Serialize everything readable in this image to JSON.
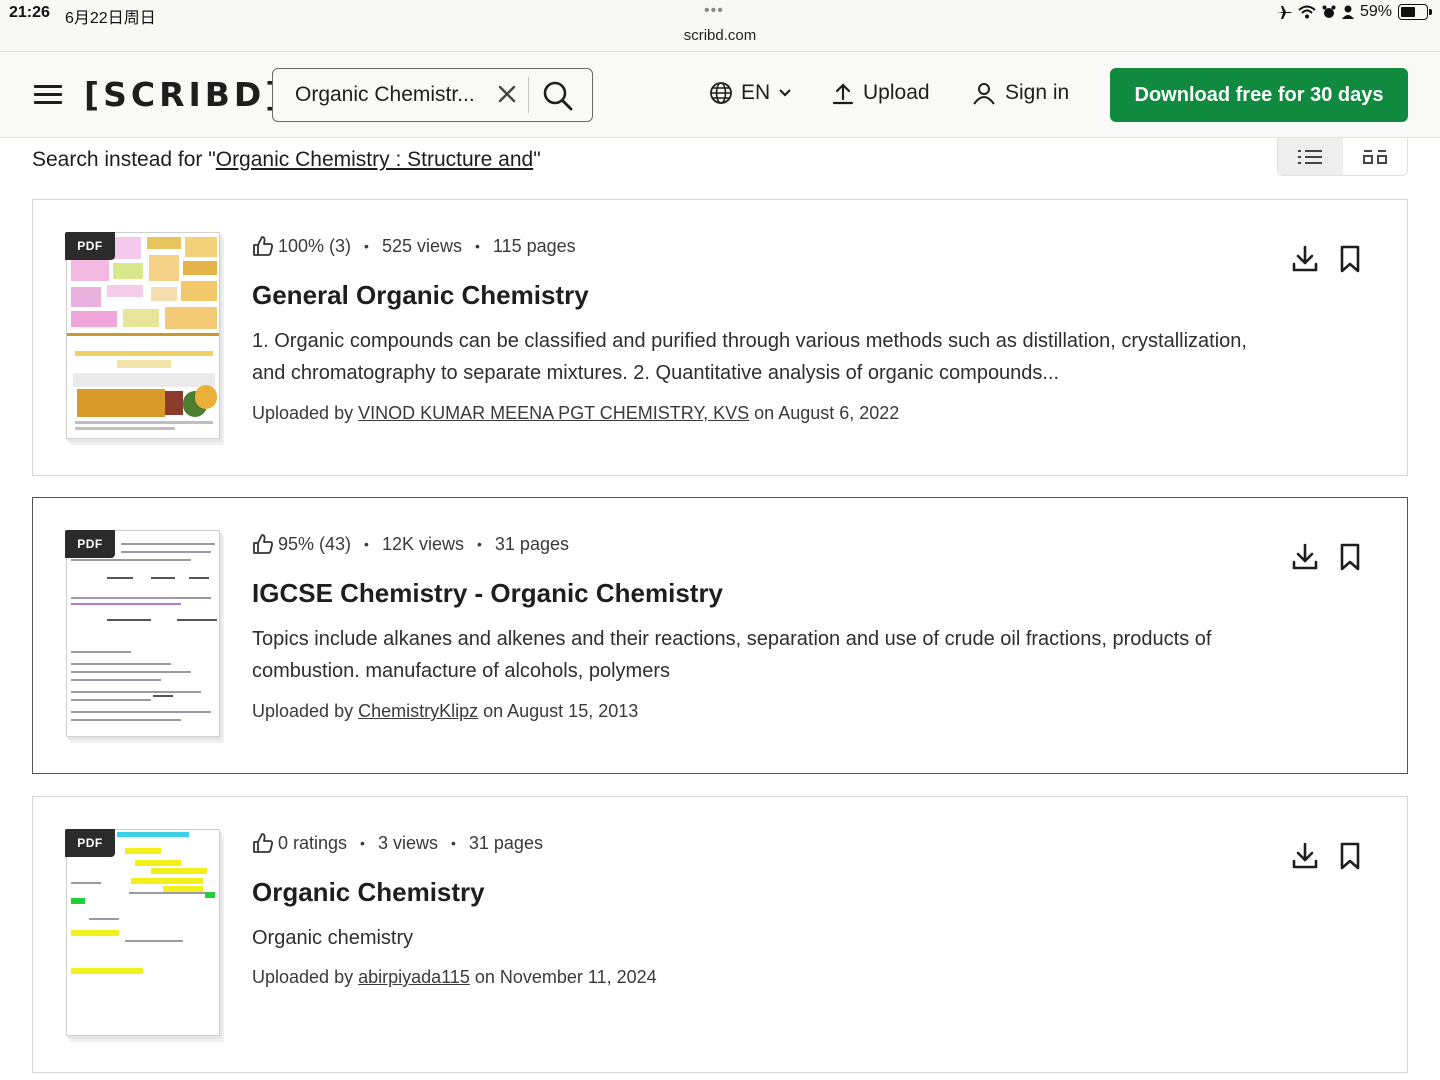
{
  "status_bar": {
    "time": "21:26",
    "date": "6月22日周日",
    "dots": "•••",
    "url": "scribd.com",
    "battery": "59%",
    "battery_level": 0.59
  },
  "header": {
    "logo": "[SCRIBD]",
    "search_value": "Organic Chemistr...",
    "language": "EN",
    "upload_label": "Upload",
    "signin_label": "Sign in",
    "cta_label": "Download free for 30 days",
    "cta_color": "#0f8a3e"
  },
  "search_instead": {
    "prefix": "Search instead for \"",
    "query": "Organic Chemistry : Structure and",
    "suffix": "\""
  },
  "results": [
    {
      "badge": "PDF",
      "rating": "100% (3)",
      "views": "525 views",
      "pages": "115 pages",
      "title": "General Organic Chemistry",
      "description": "1. Organic compounds can be classified and purified through various methods such as distillation, crystallization, and chromatography to separate mixtures. 2. Quantitative analysis of organic compounds...",
      "uploaded_prefix": "Uploaded by ",
      "uploader": "VINOD KUMAR MEENA PGT CHEMISTRY, KVS",
      "uploaded_date": " on August 6, 2022"
    },
    {
      "badge": "PDF",
      "rating": "95% (43)",
      "views": "12K views",
      "pages": "31 pages",
      "title": "IGCSE Chemistry - Organic Chemistry",
      "description": "Topics include alkanes and alkenes and their reactions, separation and use of crude oil fractions, products of combustion. manufacture of alcohols, polymers",
      "uploaded_prefix": "Uploaded by ",
      "uploader": "ChemistryKlipz",
      "uploaded_date": " on August 15, 2013"
    },
    {
      "badge": "PDF",
      "rating": "0 ratings",
      "views": "3 views",
      "pages": "31 pages",
      "title": "Organic Chemistry",
      "description": "Organic chemistry",
      "uploaded_prefix": "Uploaded by ",
      "uploader": "abirpiyada115",
      "uploaded_date": " on November 11, 2024"
    }
  ]
}
